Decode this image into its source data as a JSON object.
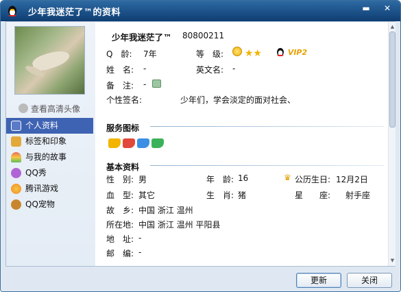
{
  "window": {
    "title": "少年我迷茫了™的资料",
    "min_glyph": "▬",
    "close_glyph": "✕"
  },
  "left": {
    "hd_avatar_link": "查看高清头像",
    "nav": [
      {
        "label": "个人资料",
        "icon": "id-card-icon",
        "color": "#5b7bc8",
        "active": true
      },
      {
        "label": "标签和印象",
        "icon": "portrait-icon",
        "color": "#e2a93a",
        "active": false
      },
      {
        "label": "与我的故事",
        "icon": "rainbow-icon",
        "color": "#e86a5b",
        "active": false
      },
      {
        "label": "QQ秀",
        "icon": "qq-show-icon",
        "color": "#b065d6",
        "active": false
      },
      {
        "label": "腾讯游戏",
        "icon": "game-icon",
        "color": "#f08a24",
        "active": false
      },
      {
        "label": "QQ宠物",
        "icon": "pet-icon",
        "color": "#c8862c",
        "active": false
      }
    ]
  },
  "profile": {
    "nickname": "少年我迷茫了™",
    "qq_number": "80800211",
    "qage_label": "Q　龄:",
    "qage_value": "7年",
    "level_label": "等　级:",
    "vip_text": "VIP2",
    "name_label": "姓　名:",
    "name_value": "-",
    "english_label": "英文名:",
    "english_value": "-",
    "remark_label": "备　注:",
    "remark_value": "-",
    "signature_label": "个性签名:",
    "signature_value": "少年们，学会淡定的面对社会、"
  },
  "sections": {
    "service_icons": "服务图标",
    "basic_info": "基本资料"
  },
  "basic": {
    "gender_label": "性　别:",
    "gender_value": "男",
    "age_label": "年　龄:",
    "age_value": "16",
    "birthday_label": "公历生日:",
    "birthday_value": "12月2日",
    "blood_label": "血　型:",
    "blood_value": "其它",
    "zodiac_label": "生　肖:",
    "zodiac_value": "猪",
    "constellation_label": "星　　座:",
    "constellation_value": "射手座",
    "hometown_label": "故　乡:",
    "hometown_value": "中国 浙江 温州",
    "location_label": "所在地:",
    "location_value": "中国 浙江 温州 平阳县",
    "address_label": "地　址:",
    "address_value": "-",
    "postcode_label": "邮　编:",
    "postcode_value": "-"
  },
  "buttons": {
    "refresh": "更新",
    "close": "关闭"
  },
  "colors": {
    "titlebar": "#1a4f86",
    "nav_active": "#3f63b3",
    "star": "#f2b400",
    "vip": "#e8a000"
  }
}
